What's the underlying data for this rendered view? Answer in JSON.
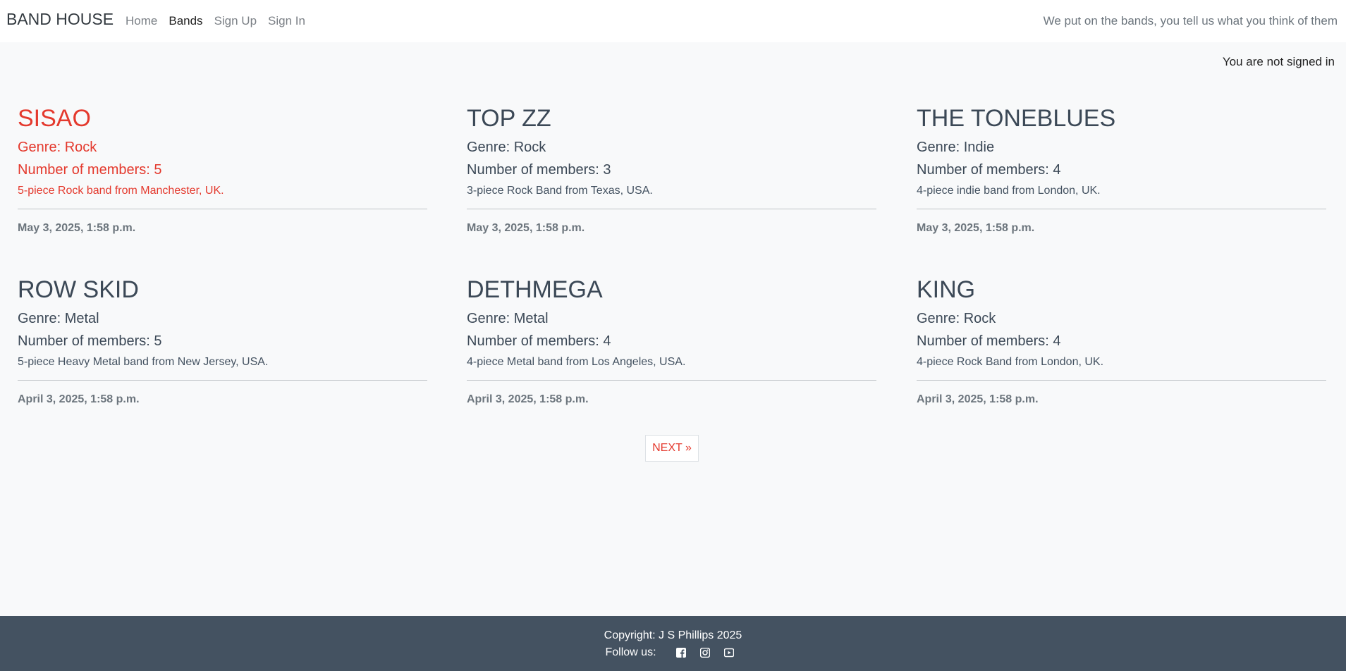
{
  "navbar": {
    "brand": "BAND HOUSE",
    "links": [
      "Home",
      "Bands",
      "Sign Up",
      "Sign In"
    ],
    "active": "Bands",
    "tagline": "We put on the bands, you tell us what you think of them"
  },
  "status": "You are not signed in",
  "bands": [
    {
      "name": "SISAO",
      "genre": "Genre: Rock",
      "members": "Number of members: 5",
      "description": "5-piece Rock band from Manchester, UK.",
      "date": "May 3, 2025, 1:58 p.m."
    },
    {
      "name": "TOP ZZ",
      "genre": "Genre: Rock",
      "members": "Number of members: 3",
      "description": "3-piece Rock Band from Texas, USA.",
      "date": "May 3, 2025, 1:58 p.m."
    },
    {
      "name": "THE TONEBLUES",
      "genre": "Genre: Indie",
      "members": "Number of members: 4",
      "description": "4-piece indie band from London, UK.",
      "date": "May 3, 2025, 1:58 p.m."
    },
    {
      "name": "ROW SKID",
      "genre": "Genre: Metal",
      "members": "Number of members: 5",
      "description": "5-piece Heavy Metal band from New Jersey, USA.",
      "date": "April 3, 2025, 1:58 p.m."
    },
    {
      "name": "DETHMEGA",
      "genre": "Genre: Metal",
      "members": "Number of members: 4",
      "description": "4-piece Metal band from Los Angeles, USA.",
      "date": "April 3, 2025, 1:58 p.m."
    },
    {
      "name": "KING",
      "genre": "Genre: Rock",
      "members": "Number of members: 4",
      "description": "4-piece Rock Band from London, UK.",
      "date": "April 3, 2025, 1:58 p.m."
    }
  ],
  "pagination": {
    "next_label": "NEXT »"
  },
  "footer": {
    "copyright": "Copyright: J S Phillips 2025",
    "follow_label": "Follow us:",
    "social": [
      "facebook-icon",
      "instagram-icon",
      "youtube-icon"
    ]
  },
  "colors": {
    "accent": "#e4392d",
    "footer_bg": "#445261",
    "page_bg": "#f8f9fa"
  }
}
